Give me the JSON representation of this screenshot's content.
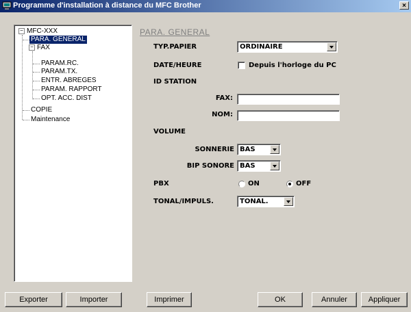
{
  "window": {
    "title": "Programme d'installation à distance du MFC Brother",
    "close": "×"
  },
  "tree": {
    "root": "MFC-XXX",
    "root_toggle": "−",
    "items": {
      "para_general": "PARA. GENERAL",
      "fax": "FAX",
      "param_rc": "PARAM.RC.",
      "param_tx": "PARAM.TX.",
      "entr_abreges": "ENTR. ABREGES",
      "param_rapport": "PARAM. RAPPORT",
      "opt_acc_dist": "OPT. ACC. DIST",
      "copie": "COPIE",
      "maintenance": "Maintenance"
    },
    "fax_toggle": "−",
    "selected": "PARA. GENERAL"
  },
  "panel": {
    "section_title": "PARA. GENERAL",
    "typ_papier_label": "TYP.PAPIER",
    "typ_papier_value": "ORDINAIRE",
    "date_heure_label": "DATE/HEURE",
    "date_heure_checkbox_label": "Depuis l'horloge du PC",
    "date_heure_checked": false,
    "id_station_label": "ID STATION",
    "fax_label": "FAX:",
    "fax_value": "",
    "nom_label": "NOM:",
    "nom_value": "",
    "volume_label": "VOLUME",
    "sonnerie_label": "SONNERIE",
    "sonnerie_value": "BAS",
    "bip_sonore_label": "BIP SONORE",
    "bip_sonore_value": "BAS",
    "pbx_label": "PBX",
    "pbx_on": "ON",
    "pbx_off": "OFF",
    "pbx_selected": "OFF",
    "tonal_label": "TONAL/IMPULS.",
    "tonal_value": "TONAL."
  },
  "buttons": {
    "exporter": "Exporter",
    "importer": "Importer",
    "imprimer": "Imprimer",
    "ok": "OK",
    "annuler": "Annuler",
    "appliquer": "Appliquer"
  }
}
